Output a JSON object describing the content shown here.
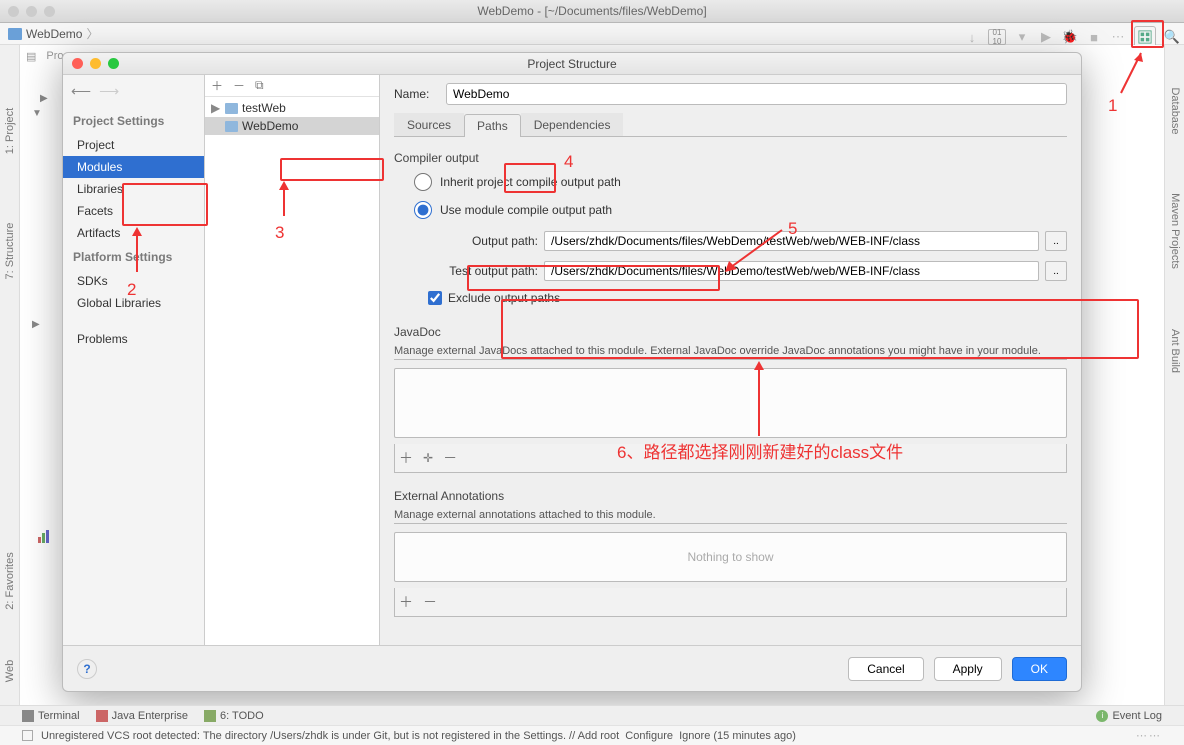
{
  "window": {
    "title": "WebDemo - [~/Documents/files/WebDemo]"
  },
  "breadcrumb": {
    "project": "WebDemo"
  },
  "toolbar": {
    "proj_label": "Pro"
  },
  "right_tools": {
    "sidebar": [
      "Database",
      "Maven Projects",
      "Ant Build"
    ]
  },
  "left_tools": {
    "sidebar": [
      "1: Project",
      "7: Structure",
      "2: Favorites",
      "Web"
    ]
  },
  "dialog": {
    "title": "Project Structure",
    "left": {
      "project_settings": "Project Settings",
      "items1": [
        "Project",
        "Modules",
        "Libraries",
        "Facets",
        "Artifacts"
      ],
      "platform_settings": "Platform Settings",
      "items2": [
        "SDKs",
        "Global Libraries"
      ],
      "problems": "Problems"
    },
    "middle": {
      "tree": [
        {
          "label": "testWeb",
          "sel": false
        },
        {
          "label": "WebDemo",
          "sel": true
        }
      ]
    },
    "main": {
      "name_label": "Name:",
      "name_value": "WebDemo",
      "tabs": [
        "Sources",
        "Paths",
        "Dependencies"
      ],
      "compiler_output": "Compiler output",
      "radio_inherit": "Inherit project compile output path",
      "radio_module": "Use module compile output path",
      "output_path_label": "Output path:",
      "output_path": "/Users/zhdk/Documents/files/WebDemo/testWeb/web/WEB-INF/class",
      "test_output_label": "Test output path:",
      "test_output_path": "/Users/zhdk/Documents/files/WebDemo/testWeb/web/WEB-INF/class",
      "exclude_label": "Exclude output paths",
      "javadoc_title": "JavaDoc",
      "javadoc_desc": "Manage external JavaDocs attached to this module. External JavaDoc override JavaDoc annotations you might have in your module.",
      "ext_ann_title": "External Annotations",
      "ext_ann_desc": "Manage external annotations attached to this module.",
      "nothing": "Nothing to show"
    },
    "footer": {
      "cancel": "Cancel",
      "apply": "Apply",
      "ok": "OK"
    }
  },
  "bottom": {
    "terminal": "Terminal",
    "java_ee": "Java Enterprise",
    "todo": "6: TODO",
    "event_log": "Event Log",
    "status": "Unregistered VCS root detected: The directory /Users/zhdk is under Git, but is not registered in the Settings. // Add root  Configure  Ignore (15 minutes ago)",
    "meta": "⋯⋯"
  },
  "annotations": {
    "n1": "1",
    "n2": "2",
    "n3": "3",
    "n4": "4",
    "n5": "5",
    "n6": "6、路径都选择刚刚新建好的class文件"
  }
}
